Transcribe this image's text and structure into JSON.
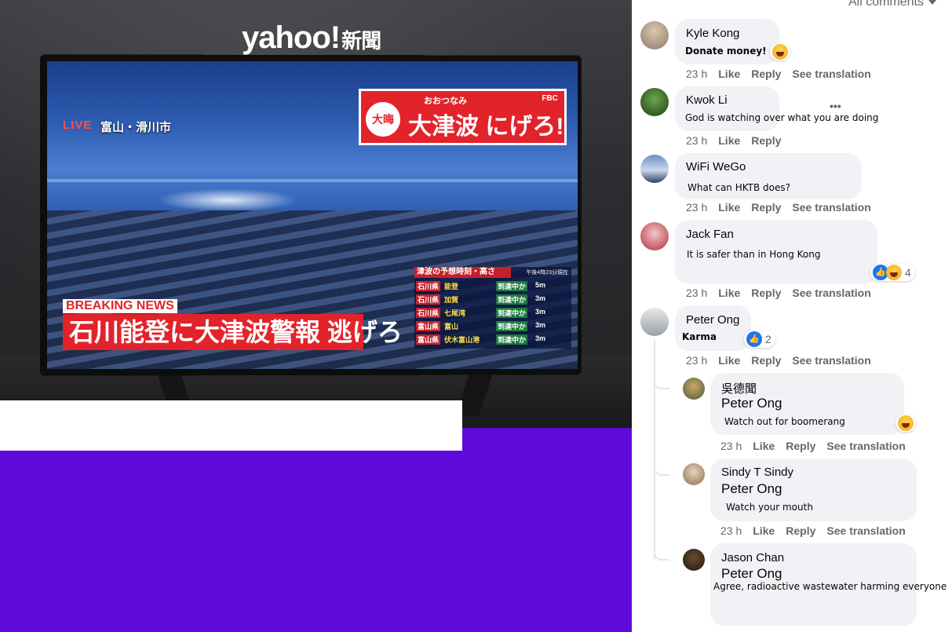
{
  "media": {
    "brand": "yahoo!",
    "brand_cn": "新聞",
    "live_label": "LIVE",
    "place_label": "富山・滑川市",
    "alert_kana": "おおつなみ",
    "alert_logo": "大晦",
    "alert_main": "大津波 にげろ!",
    "alert_network": "FBC",
    "breaking_label": "BREAKING NEWS",
    "headline": "石川能登に大津波警報 逃げろ",
    "forecast_title": "津波の予想時刻・高さ",
    "forecast_time": "午後4時23分現在",
    "forecast_rows": [
      {
        "pref": "石川県",
        "area": "能登",
        "arrival": "到達中か",
        "height": "5m"
      },
      {
        "pref": "石川県",
        "area": "加賀",
        "arrival": "到達中か",
        "height": "3m"
      },
      {
        "pref": "石川県",
        "area": "七尾湾",
        "arrival": "到達中か",
        "height": "3m"
      },
      {
        "pref": "富山県",
        "area": "富山",
        "arrival": "到達中か",
        "height": "3m"
      },
      {
        "pref": "富山県",
        "area": "伏木富山港",
        "arrival": "到達中か",
        "height": "3m"
      }
    ]
  },
  "comments_panel": {
    "filter_label": "All comments",
    "like_label": "Like",
    "reply_label": "Reply",
    "translate_label": "See translation",
    "comments": [
      {
        "name": "Kyle Kong",
        "text": "Donate money!",
        "time": "23 h"
      },
      {
        "name": "Kwok Li",
        "text": "God is watching over what you are doing",
        "time": "23 h"
      },
      {
        "name": "WiFi WeGo",
        "text": "What can HKTB does?",
        "time": "23 h"
      },
      {
        "name": "Jack Fan",
        "text": "It is safer than in Hong Kong",
        "time": "23 h",
        "reaction_count": "4"
      },
      {
        "name": "Peter Ong",
        "text": "Karma",
        "time": "23 h",
        "reaction_count": "2"
      }
    ],
    "replies": [
      {
        "name": "吳德聞",
        "mention": "Peter Ong",
        "text": "Watch out for boomerang",
        "time": "23 h"
      },
      {
        "name": "Sindy T Sindy",
        "mention": "Peter Ong",
        "text": "Watch your mouth",
        "time": "23 h"
      },
      {
        "name": "Jason Chan",
        "mention": "Peter Ong",
        "text": "Agree, radioactive wastewater harming everyone"
      }
    ],
    "more_icon": "more-options-icon",
    "colors": {
      "bubble": "#f0f2f5",
      "meta": "#65676b",
      "like_blue": "#1877f2",
      "banner_purple": "#5e0ad8"
    }
  }
}
